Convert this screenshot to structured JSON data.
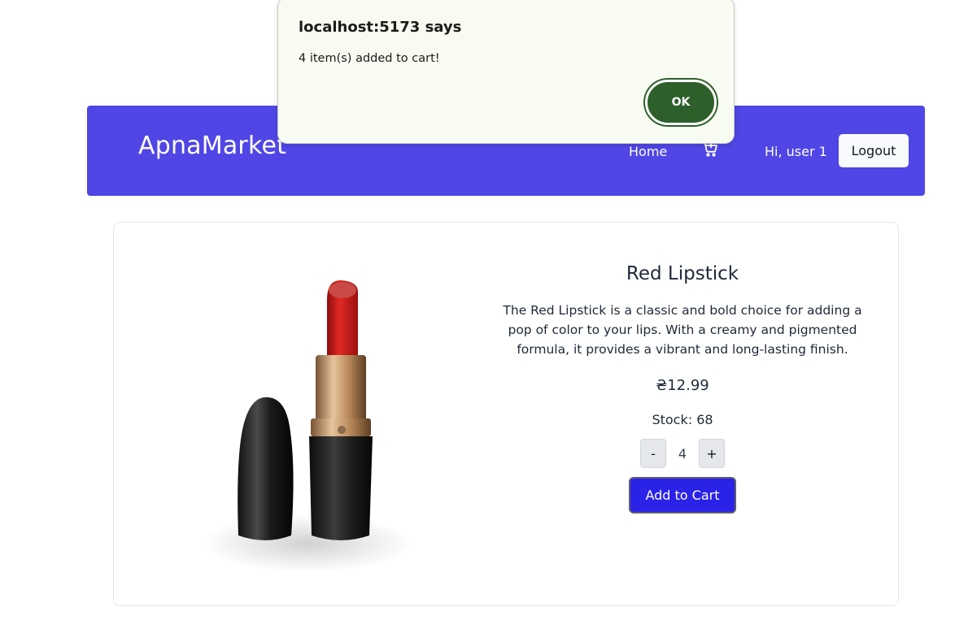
{
  "navbar": {
    "brand": "ApnaMarket",
    "home_label": "Home",
    "cart_icon": "cart-icon",
    "greeting": "Hi, user 1",
    "logout_label": "Logout",
    "background_color": "#4f46e5"
  },
  "product": {
    "image": "red-lipstick-image",
    "title": "Red Lipstick",
    "description": "The Red Lipstick is a classic and bold choice for adding a pop of color to your lips. With a creamy and pigmented formula, it provides a vibrant and long-lasting finish.",
    "price": "₴12.99",
    "stock": "Stock: 68",
    "quantity": "4",
    "decrement_label": "-",
    "increment_label": "+",
    "add_to_cart_label": "Add to Cart",
    "button_color": "#2b22e8"
  },
  "alert": {
    "title": "localhost:5173 says",
    "message": "4 item(s) added to cart!",
    "ok_label": "OK",
    "ok_color": "#2d5f2a"
  }
}
